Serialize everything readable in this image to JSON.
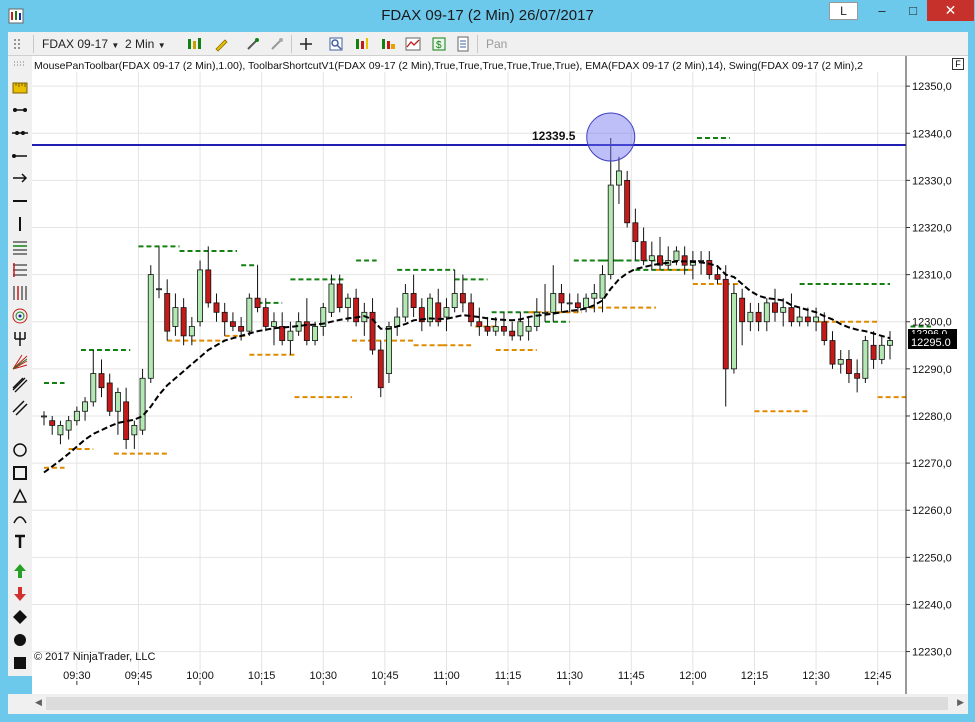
{
  "window": {
    "title": "FDAX 09-17 (2 Min)  26/07/2017",
    "btn_l": "L",
    "btn_min": "–",
    "btn_max": "□",
    "btn_close": "✕"
  },
  "toolbar": {
    "instrument": "FDAX 09-17",
    "interval": "2 Min",
    "pan": "Pan"
  },
  "indicators": "MousePanToolbar(FDAX 09-17 (2 Min),1.00), ToolbarShortcutV1(FDAX 09-17 (2 Min),True,True,True,True,True,True), EMA(FDAX 09-17 (2 Min),14), Swing(FDAX 09-17 (2 Min),2",
  "price_axis_box": "F",
  "copyright": "© 2017 NinjaTrader, LLC",
  "horizontal_line_label": "12339.5",
  "last_price_labels": [
    "12296.0",
    "12295.0"
  ],
  "colors": {
    "up_candle": "#b2e8b2",
    "down_candle": "#c41a1a",
    "ema": "#000000",
    "swing_high": "#148014",
    "swing_low": "#e08a00",
    "h_line": "#1f1fb4",
    "highlight": "#8080ff"
  },
  "chart_data": {
    "type": "candlestick",
    "title": "",
    "x_ticks": [
      "09:30",
      "09:45",
      "10:00",
      "10:15",
      "10:30",
      "10:45",
      "11:00",
      "11:15",
      "11:30",
      "11:45",
      "12:00",
      "12:15",
      "12:30",
      "12:45"
    ],
    "y_ticks": [
      12230,
      12240,
      12250,
      12260,
      12270,
      12280,
      12290,
      12300,
      12310,
      12320,
      12330,
      12340,
      12350
    ],
    "ylim": [
      12228,
      12353
    ],
    "horizontal_line": 12337.5,
    "candles": [
      [
        12280,
        12281,
        12278,
        12280
      ],
      [
        12279,
        12280,
        12276,
        12278
      ],
      [
        12276,
        12279,
        12274,
        12278
      ],
      [
        12277,
        12280,
        12275,
        12279
      ],
      [
        12279,
        12282,
        12278,
        12281
      ],
      [
        12281,
        12284,
        12279,
        12283
      ],
      [
        12283,
        12294,
        12282,
        12289
      ],
      [
        12289,
        12292,
        12284,
        12286
      ],
      [
        12287,
        12289,
        12280,
        12281
      ],
      [
        12281,
        12286,
        12276,
        12285
      ],
      [
        12283,
        12286,
        12273,
        12275
      ],
      [
        12276,
        12279,
        12273,
        12278
      ],
      [
        12277,
        12290,
        12276,
        12288
      ],
      [
        12288,
        12312,
        12287,
        12310
      ],
      [
        12307,
        12316,
        12305,
        12307
      ],
      [
        12306,
        12309,
        12296,
        12298
      ],
      [
        12299,
        12306,
        12297,
        12303
      ],
      [
        12303,
        12305,
        12295,
        12297
      ],
      [
        12297,
        12301,
        12295,
        12299
      ],
      [
        12300,
        12313,
        12299,
        12311
      ],
      [
        12311,
        12316,
        12303,
        12304
      ],
      [
        12304,
        12306,
        12300,
        12302
      ],
      [
        12302,
        12304,
        12297,
        12300
      ],
      [
        12300,
        12302,
        12298,
        12299
      ],
      [
        12299,
        12301,
        12296,
        12298
      ],
      [
        12298,
        12306,
        12297,
        12305
      ],
      [
        12305,
        12312,
        12302,
        12303
      ],
      [
        12303,
        12305,
        12298,
        12299
      ],
      [
        12299,
        12302,
        12295,
        12300
      ],
      [
        12299,
        12302,
        12295,
        12296
      ],
      [
        12296,
        12300,
        12293,
        12298
      ],
      [
        12298,
        12302,
        12297,
        12300
      ],
      [
        12300,
        12305,
        12295,
        12296
      ],
      [
        12296,
        12300,
        12295,
        12299
      ],
      [
        12299,
        12304,
        12297,
        12303
      ],
      [
        12302,
        12310,
        12301,
        12308
      ],
      [
        12308,
        12310,
        12302,
        12303
      ],
      [
        12303,
        12306,
        12300,
        12305
      ],
      [
        12305,
        12307,
        12299,
        12300
      ],
      [
        12300,
        12304,
        12297,
        12302
      ],
      [
        12302,
        12305,
        12293,
        12294
      ],
      [
        12294,
        12296,
        12284,
        12286
      ],
      [
        12289,
        12300,
        12287,
        12299
      ],
      [
        12299,
        12303,
        12297,
        12301
      ],
      [
        12301,
        12308,
        12300,
        12306
      ],
      [
        12306,
        12310,
        12301,
        12303
      ],
      [
        12303,
        12305,
        12298,
        12300
      ],
      [
        12300,
        12306,
        12299,
        12305
      ],
      [
        12304,
        12307,
        12299,
        12300
      ],
      [
        12301,
        12305,
        12298,
        12303
      ],
      [
        12303,
        12311,
        12302,
        12306
      ],
      [
        12306,
        12310,
        12302,
        12304
      ],
      [
        12304,
        12306,
        12299,
        12300
      ],
      [
        12300,
        12303,
        12297,
        12299
      ],
      [
        12299,
        12301,
        12297,
        12298
      ],
      [
        12298,
        12301,
        12297,
        12299
      ],
      [
        12299,
        12302,
        12297,
        12298
      ],
      [
        12298,
        12300,
        12296,
        12297
      ],
      [
        12297,
        12302,
        12296,
        12300
      ],
      [
        12298,
        12301,
        12296,
        12299
      ],
      [
        12299,
        12305,
        12298,
        12302
      ],
      [
        12302,
        12308,
        12300,
        12302
      ],
      [
        12302,
        12312,
        12300,
        12306
      ],
      [
        12306,
        12308,
        12302,
        12304
      ],
      [
        12304,
        12306,
        12302,
        12304
      ],
      [
        12304,
        12306,
        12302,
        12303
      ],
      [
        12303,
        12306,
        12302,
        12305
      ],
      [
        12305,
        12308,
        12302,
        12306
      ],
      [
        12305,
        12312,
        12302,
        12310
      ],
      [
        12310,
        12339,
        12309,
        12329
      ],
      [
        12329,
        12335,
        12325,
        12332
      ],
      [
        12330,
        12332,
        12320,
        12321
      ],
      [
        12321,
        12324,
        12313,
        12317
      ],
      [
        12317,
        12320,
        12312,
        12313
      ],
      [
        12313,
        12317,
        12311,
        12314
      ],
      [
        12314,
        12318,
        12311,
        12312
      ],
      [
        12312,
        12316,
        12311,
        12313
      ],
      [
        12313,
        12316,
        12312,
        12315
      ],
      [
        12314,
        12316,
        12310,
        12312
      ],
      [
        12312,
        12315,
        12309,
        12313
      ],
      [
        12313,
        12315,
        12310,
        12313
      ],
      [
        12313,
        12315,
        12309,
        12310
      ],
      [
        12310,
        12312,
        12308,
        12309
      ],
      [
        12309,
        12312,
        12282,
        12290
      ],
      [
        12290,
        12308,
        12289,
        12306
      ],
      [
        12305,
        12307,
        12295,
        12300
      ],
      [
        12300,
        12304,
        12298,
        12302
      ],
      [
        12302,
        12304,
        12298,
        12300
      ],
      [
        12300,
        12305,
        12298,
        12304
      ],
      [
        12304,
        12307,
        12300,
        12302
      ],
      [
        12302,
        12305,
        12299,
        12303
      ],
      [
        12303,
        12306,
        12299,
        12300
      ],
      [
        12300,
        12303,
        12299,
        12301
      ],
      [
        12301,
        12303,
        12299,
        12300
      ],
      [
        12300,
        12303,
        12298,
        12301
      ],
      [
        12300,
        12302,
        12295,
        12296
      ],
      [
        12296,
        12298,
        12290,
        12291
      ],
      [
        12291,
        12294,
        12289,
        12292
      ],
      [
        12292,
        12294,
        12287,
        12289
      ],
      [
        12289,
        12292,
        12285,
        12288
      ],
      [
        12288,
        12297,
        12287,
        12296
      ],
      [
        12295,
        12298,
        12290,
        12292
      ],
      [
        12292,
        12297,
        12291,
        12295
      ],
      [
        12295,
        12298,
        12292,
        12296
      ]
    ],
    "ema": [
      12268,
      12269.3,
      12270.6,
      12272,
      12273.5,
      12275,
      12276.2,
      12277,
      12277.8,
      12278.5,
      12278.9,
      12279.2,
      12280,
      12282,
      12284.5,
      12286.5,
      12288,
      12289.5,
      12291,
      12292.5,
      12294,
      12295,
      12296,
      12296.5,
      12297,
      12297.5,
      12298,
      12298.3,
      12298.6,
      12298.8,
      12298.9,
      12299.1,
      12299.3,
      12299.4,
      12299.6,
      12300,
      12300.4,
      12300.7,
      12300.9,
      12301.2,
      12300.5,
      12298.5,
      12298.5,
      12299,
      12299.5,
      12300.3,
      12300.5,
      12300.7,
      12300.6,
      12300.6,
      12301,
      12301.4,
      12301.2,
      12301,
      12300.7,
      12300.5,
      12300.4,
      12300.3,
      12300.5,
      12301,
      12301.3,
      12301.5,
      12301.7,
      12302,
      12302.3,
      12302.5,
      12302.8,
      12303.5,
      12304.5,
      12307,
      12309,
      12310.3,
      12311.2,
      12311.6,
      12312,
      12312.3,
      12312.5,
      12312.8,
      12312.8,
      12312.7,
      12312.6,
      12312.3,
      12311.8,
      12310,
      12309.5,
      12308,
      12306.5,
      12305.5,
      12305,
      12304.8,
      12304.5,
      12303.5,
      12303,
      12302.5,
      12302,
      12301.2,
      12300.5,
      12299.5,
      12298.8,
      12298.3,
      12298,
      12297.5,
      12297,
      12296.5
    ],
    "swing_highs": [
      [
        0,
        5,
        12287
      ],
      [
        9,
        21,
        12294
      ],
      [
        23,
        33,
        12316
      ],
      [
        33,
        47,
        12315
      ],
      [
        48,
        52,
        12312
      ],
      [
        52,
        58,
        12304
      ],
      [
        60,
        73,
        12309
      ],
      [
        76,
        81,
        12313
      ],
      [
        86,
        100,
        12311
      ],
      [
        100,
        108,
        12309
      ],
      [
        109,
        121,
        12302
      ],
      [
        122,
        128,
        12300
      ],
      [
        129,
        140,
        12313
      ],
      [
        136,
        151,
        12313
      ],
      [
        144,
        157,
        12311
      ],
      [
        159,
        167,
        12339
      ],
      [
        184,
        206,
        12308
      ],
      [
        211,
        216,
        12299
      ]
    ],
    "swing_lows": [
      [
        0,
        5,
        12269
      ],
      [
        6,
        12,
        12273
      ],
      [
        17,
        30,
        12272
      ],
      [
        30,
        44,
        12296
      ],
      [
        44,
        49,
        12297
      ],
      [
        50,
        61,
        12293
      ],
      [
        61,
        75,
        12284
      ],
      [
        75,
        90,
        12296
      ],
      [
        90,
        97,
        12295
      ],
      [
        97,
        104,
        12295
      ],
      [
        105,
        110,
        12299
      ],
      [
        110,
        120,
        12294
      ],
      [
        118,
        125,
        12302
      ],
      [
        125,
        131,
        12302
      ],
      [
        133,
        149,
        12303
      ],
      [
        149,
        158,
        12311
      ],
      [
        158,
        169,
        12308
      ],
      [
        173,
        186,
        12281
      ],
      [
        188,
        203,
        12300
      ],
      [
        203,
        210,
        12284
      ]
    ]
  }
}
